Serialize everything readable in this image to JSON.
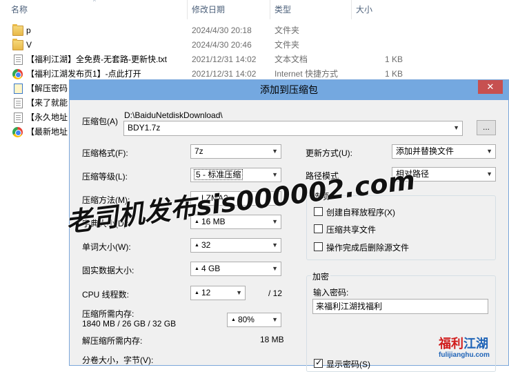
{
  "explorer": {
    "columns": {
      "name": "名称",
      "date": "修改日期",
      "type": "类型",
      "size": "大小"
    },
    "files": [
      {
        "icon": "folder-icon",
        "name": "p",
        "date": "2024/4/30 20:18",
        "type": "文件夹",
        "size": ""
      },
      {
        "icon": "folder-icon",
        "name": "V",
        "date": "2024/4/30 20:46",
        "type": "文件夹",
        "size": ""
      },
      {
        "icon": "text-file-icon",
        "name": "【福利江湖】全免费-无套路-更新快.txt",
        "date": "2021/12/31 14:02",
        "type": "文本文档",
        "size": "1 KB"
      },
      {
        "icon": "chrome-icon",
        "name": "【福利江湖发布页1】-点此打开",
        "date": "2021/12/31 14:02",
        "type": "Internet 快捷方式",
        "size": "1 KB"
      },
      {
        "icon": "notes-icon",
        "name": "【解压密码",
        "date": "",
        "type": "",
        "size": ""
      },
      {
        "icon": "text-file-icon",
        "name": "【来了就能",
        "date": "",
        "type": "",
        "size": ""
      },
      {
        "icon": "text-file-icon",
        "name": "【永久地址",
        "date": "",
        "type": "",
        "size": ""
      },
      {
        "icon": "chrome-icon",
        "name": "【最新地址",
        "date": "",
        "type": "",
        "size": ""
      }
    ]
  },
  "dialog": {
    "title": "添加到压缩包",
    "close": "✕",
    "archive_label": "压缩包(A)",
    "archive_path": "D:\\BaiduNetdiskDownload\\",
    "archive_name": "BDY1.7z",
    "browse": "...",
    "format_label": "压缩格式(F):",
    "format_value": "7z",
    "level_label": "压缩等级(L):",
    "level_value": "5 - 标准压缩",
    "method_label": "压缩方法(M):",
    "method_value": "LZMA2",
    "dict_label": "字典大小(D):",
    "dict_value": "16 MB",
    "word_label": "单词大小(W):",
    "word_value": "32",
    "solid_label": "固实数据大小:",
    "solid_value": "4 GB",
    "threads_label": "CPU 线程数:",
    "threads_value": "12",
    "threads_max": "/ 12",
    "mem_label": "压缩所需内存:",
    "mem_detail": "1840 MB / 26 GB / 32 GB",
    "mem_percent": "80%",
    "decomp_label": "解压缩所需内存:",
    "decomp_value": "18 MB",
    "split_label": "分卷大小，字节(V):",
    "update_label": "更新方式(U):",
    "update_value": "添加并替换文件",
    "path_label": "路径模式",
    "path_value": "相对路径",
    "options_title": "选项",
    "options": [
      {
        "label": "创建自释放程序(X)",
        "checked": false
      },
      {
        "label": "压缩共享文件",
        "checked": false
      },
      {
        "label": "操作完成后删除源文件",
        "checked": false
      }
    ],
    "encrypt_title": "加密",
    "password_label": "输入密码:",
    "password_value": "来福利江湖找福利",
    "show_password_label": "显示密码(S)",
    "show_password_checked": true
  },
  "watermark": {
    "text": "老司机发布sis000002.com",
    "logo_part1": "福利",
    "logo_part2": "江湖",
    "logo_url": "fulijianghu.com"
  }
}
